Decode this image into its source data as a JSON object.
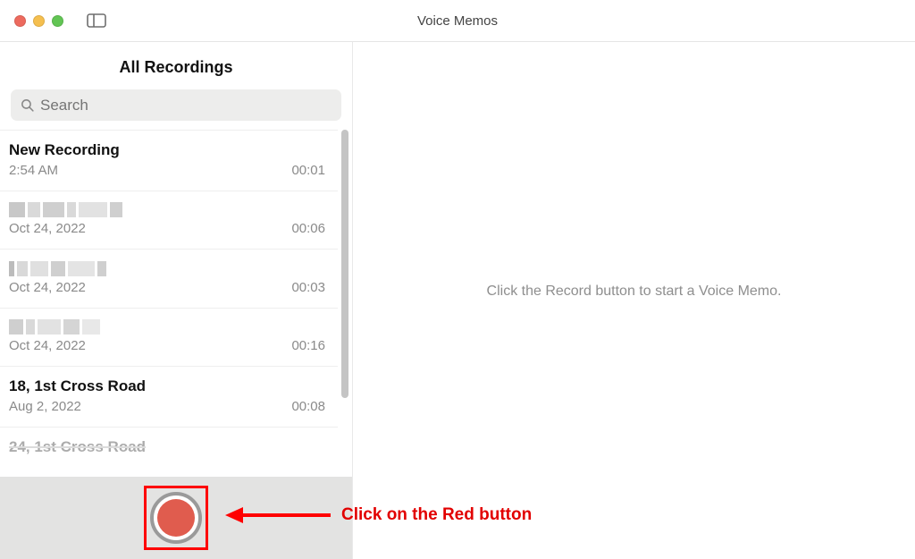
{
  "window": {
    "title": "Voice Memos"
  },
  "sidebar": {
    "heading": "All Recordings",
    "search_placeholder": "Search"
  },
  "recordings": [
    {
      "title": "New Recording",
      "date": "2:54 AM",
      "duration": "00:01",
      "redacted": false
    },
    {
      "title": "",
      "date": "Oct 24, 2022",
      "duration": "00:06",
      "redacted": true
    },
    {
      "title": "",
      "date": "Oct 24, 2022",
      "duration": "00:03",
      "redacted": true
    },
    {
      "title": "",
      "date": "Oct 24, 2022",
      "duration": "00:16",
      "redacted": true
    },
    {
      "title": "18, 1st Cross Road",
      "date": "Aug 2, 2022",
      "duration": "00:08",
      "redacted": false
    },
    {
      "title": "24, 1st Cross Road",
      "date": "",
      "duration": "",
      "redacted": false
    }
  ],
  "main": {
    "placeholder": "Click the Record button to start a Voice Memo."
  },
  "annotation": {
    "text": "Click on the Red button"
  }
}
